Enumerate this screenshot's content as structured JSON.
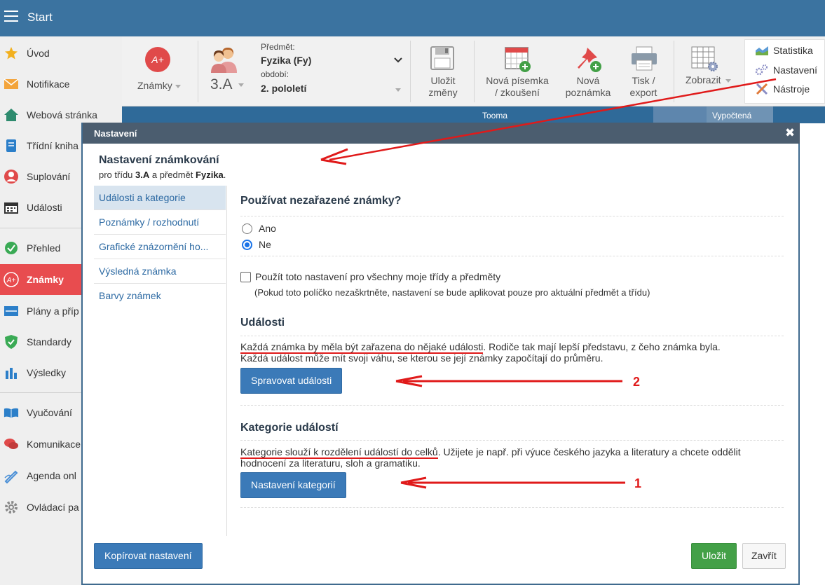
{
  "topbar": {
    "title": "Start"
  },
  "sidebar": {
    "items": [
      {
        "label": "Úvod",
        "icon": "star-icon"
      },
      {
        "label": "Notifikace",
        "icon": "envelope-icon"
      },
      {
        "label": "Webová stránka",
        "icon": "home-icon"
      },
      {
        "label": "Třídní kniha",
        "icon": "book-icon"
      },
      {
        "label": "Suplování",
        "icon": "person-icon"
      },
      {
        "label": "Události",
        "icon": "calendar-icon"
      },
      {
        "label": "Přehled",
        "icon": "check-circle-icon"
      },
      {
        "label": "Známky",
        "icon": "grade-icon"
      },
      {
        "label": "Plány a příp",
        "icon": "plan-icon"
      },
      {
        "label": "Standardy",
        "icon": "shield-icon"
      },
      {
        "label": "Výsledky",
        "icon": "bar-chart-icon"
      },
      {
        "label": "Vyučování",
        "icon": "open-book-icon"
      },
      {
        "label": "Komunikace",
        "icon": "chat-icon"
      },
      {
        "label": "Agenda onl",
        "icon": "pen-icon"
      },
      {
        "label": "Ovládací pa",
        "icon": "gear-icon"
      }
    ]
  },
  "toolbar": {
    "grades_icon_text": "A+",
    "grades_label": "Známky",
    "class_label": "3.A",
    "subject_caption": "Předmět:",
    "subject_value": "Fyzika (Fy)",
    "period_caption": "období:",
    "period_value": "2. pololetí",
    "save_line1": "Uložit",
    "save_line2": "změny",
    "new_exam_line1": "Nová písemka",
    "new_exam_line2": "/ zkoušení",
    "new_note_line1": "Nová",
    "new_note_line2": "poznámka",
    "print_line1": "Tisk /",
    "print_line2": "export",
    "show_label": "Zobrazit",
    "menu_statistics": "Statistika",
    "menu_settings": "Nastavení",
    "menu_tools": "Nástroje"
  },
  "background": {
    "cell_1": "Tooma",
    "cell_2": "Vypočtená"
  },
  "modal": {
    "header": "Nastavení",
    "close_symbol": "✖",
    "title": "Nastavení známkování",
    "sub_prefix": "pro třídu ",
    "sub_class": "3.A",
    "sub_middle": " a předmět ",
    "sub_subject": "Fyzika",
    "sub_suffix": ".",
    "nav": [
      "Události a kategorie",
      "Poznámky / rozhodnutí",
      "Grafické znázornění ho...",
      "Výsledná známka",
      "Barvy známek"
    ],
    "q_unassigned": "Používat nezařazené známky?",
    "radio_yes": "Ano",
    "radio_no": "Ne",
    "selected_option": "Ne",
    "apply_all_label": "Použít toto nastavení pro všechny moje třídy a předměty",
    "apply_all_note": "(Pokud toto políčko nezaškrtněte, nastavení se bude aplikovat pouze pro aktuální předmět a třídu)",
    "events_heading": "Události",
    "events_text_underlined": "Každá známka by měla být zařazena do nějaké události",
    "events_text_rest": ". Rodiče tak mají lepší představu, z čeho známka byla.",
    "events_text_line2": "Každá událost může mít svoji váhu, se kterou se její známky započítají do průměru.",
    "manage_events_button": "Spravovat události",
    "categories_heading": "Kategorie událostí",
    "categories_text_underlined": "Kategorie slouží k rozdělení událostí do celků",
    "categories_text_rest": ". Užijete je např. při výuce českého jazyka a literatury a chcete oddělit",
    "categories_text_line2": "hodnocení za literaturu, sloh a gramatiku.",
    "categories_button": "Nastavení kategorií",
    "copy_button": "Kopírovat nastavení",
    "save_button": "Uložit",
    "close_button": "Zavřít"
  },
  "annotations": {
    "label_2": "2",
    "label_1": "1",
    "color": "#e01a1a"
  },
  "colors": {
    "topbar": "#3b73a0",
    "active_sidebar": "#e84c4f",
    "primary_button": "#3b7ab8",
    "save_button": "#43a047"
  }
}
